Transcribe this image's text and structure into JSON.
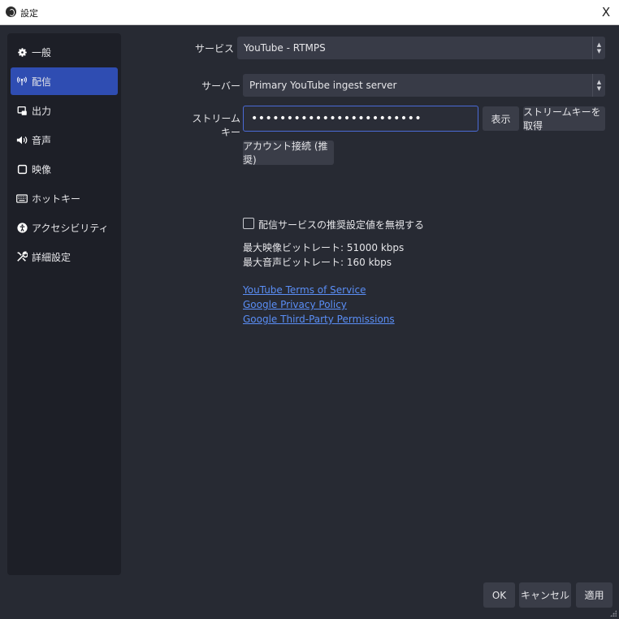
{
  "window": {
    "title": "設定",
    "close_glyph": "X"
  },
  "sidebar": {
    "items": [
      {
        "label": "一般",
        "icon": "gear-icon"
      },
      {
        "label": "配信",
        "icon": "broadcast-icon",
        "active": true
      },
      {
        "label": "出力",
        "icon": "output-icon"
      },
      {
        "label": "音声",
        "icon": "speaker-icon"
      },
      {
        "label": "映像",
        "icon": "monitor-icon"
      },
      {
        "label": "ホットキー",
        "icon": "keyboard-icon"
      },
      {
        "label": "アクセシビリティ",
        "icon": "accessibility-icon"
      },
      {
        "label": "詳細設定",
        "icon": "tools-icon"
      }
    ]
  },
  "stream": {
    "service_label": "サービス",
    "service_value": "YouTube - RTMPS",
    "server_label": "サーバー",
    "server_value": "Primary YouTube ingest server",
    "key_label": "ストリームキー",
    "key_value": "••••••••••••••••••••••••",
    "show_button": "表示",
    "get_key_button": "ストリームキーを取得",
    "connect_button": "アカウント接続 (推奨)",
    "ignore_checkbox_label": "配信サービスの推奨設定値を無視する",
    "ignore_checked": false,
    "max_video_bitrate": "最大映像ビットレート: 51000 kbps",
    "max_audio_bitrate": "最大音声ビットレート: 160 kbps",
    "links": [
      "YouTube Terms of Service",
      "Google Privacy Policy",
      "Google Third-Party Permissions"
    ]
  },
  "footer": {
    "ok": "OK",
    "cancel": "キャンセル",
    "apply": "適用"
  },
  "colors": {
    "background": "#272a33",
    "sidebar": "#1d1f27",
    "active": "#2f4db2",
    "link": "#5a8ef6",
    "focus_border": "#4a6ad6"
  }
}
